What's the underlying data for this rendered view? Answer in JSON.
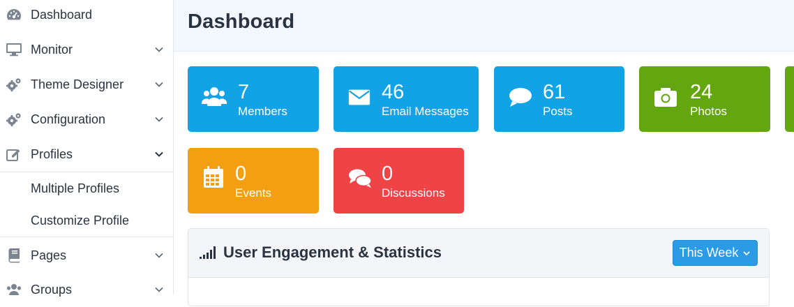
{
  "sidebar": {
    "items": [
      {
        "label": "Dashboard",
        "icon": "dashboard-icon"
      },
      {
        "label": "Monitor",
        "icon": "monitor-icon"
      },
      {
        "label": "Theme Designer",
        "icon": "gears-icon"
      },
      {
        "label": "Configuration",
        "icon": "gears-icon"
      },
      {
        "label": "Profiles",
        "icon": "edit-icon"
      },
      {
        "label": "Pages",
        "icon": "book-icon"
      },
      {
        "label": "Groups",
        "icon": "users-icon"
      }
    ],
    "profiles_sub": [
      "Multiple Profiles",
      "Customize Profile"
    ]
  },
  "header": {
    "title": "Dashboard"
  },
  "stats": [
    {
      "count": "7",
      "label": "Members",
      "icon": "users-icon",
      "color": "#12a3e6"
    },
    {
      "count": "46",
      "label": "Email Messages",
      "icon": "envelope-icon",
      "color": "#12a3e6"
    },
    {
      "count": "61",
      "label": "Posts",
      "icon": "comment-icon",
      "color": "#12a3e6"
    },
    {
      "count": "24",
      "label": "Photos",
      "icon": "camera-icon",
      "color": "#64a60f"
    },
    {
      "count": "0",
      "label": "Events",
      "icon": "calendar-icon",
      "color": "#f39f11"
    },
    {
      "count": "0",
      "label": "Discussions",
      "icon": "comments-icon",
      "color": "#ef4346"
    }
  ],
  "engagement": {
    "title": "User Engagement & Statistics",
    "icon": "signal-bars-icon",
    "period_button": "This Week"
  },
  "colors": {
    "blue": "#12a3e6",
    "green": "#64a60f",
    "orange": "#f39f11",
    "red": "#ef4346",
    "button": "#2b9be6"
  }
}
